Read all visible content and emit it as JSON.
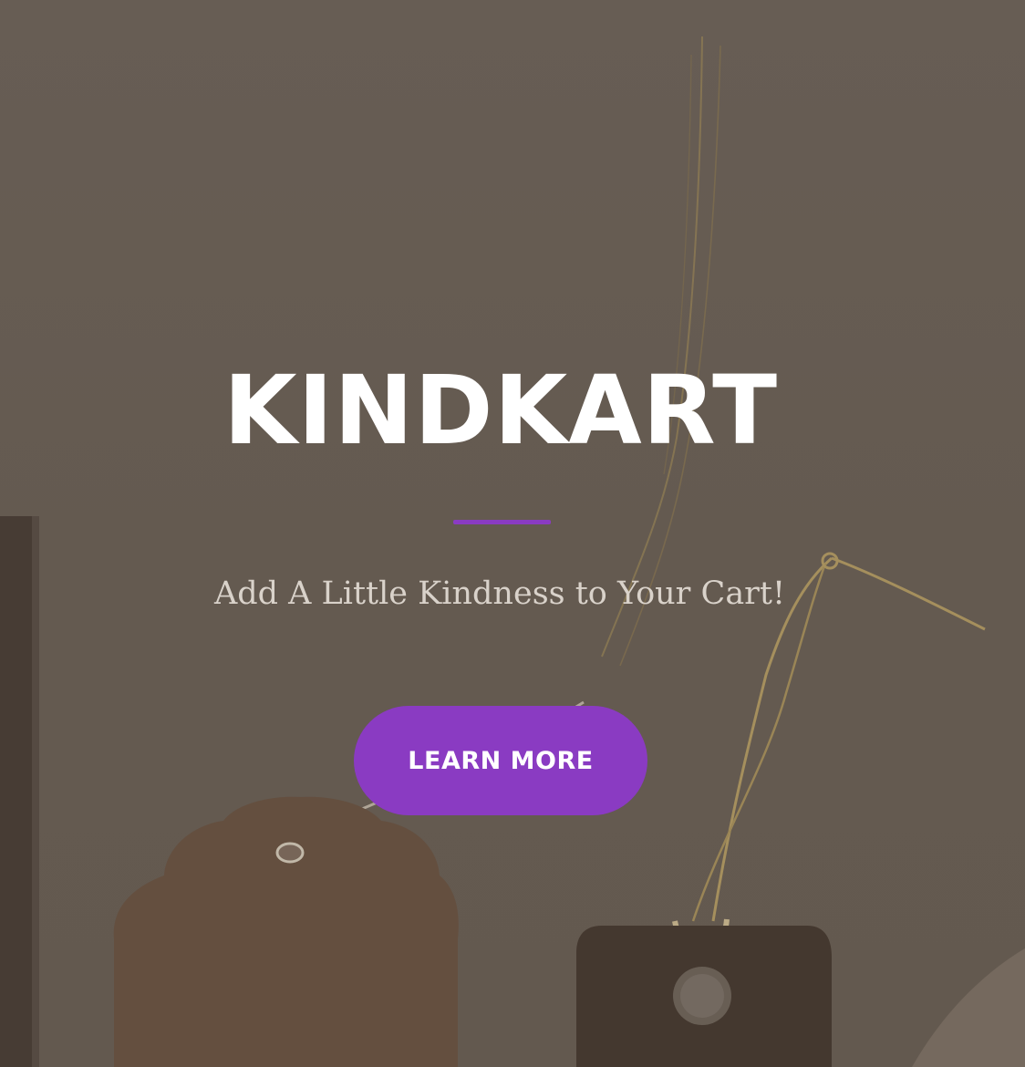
{
  "hero": {
    "title": "KINDKART",
    "tagline": "Add A Little Kindness to Your Cart!",
    "cta_label": "LEARN MORE"
  },
  "colors": {
    "accent": "#8a3bc2",
    "overlay_tint": "#6b6156",
    "title_text": "#ffffff",
    "tagline_text": "#d9d2ca"
  }
}
